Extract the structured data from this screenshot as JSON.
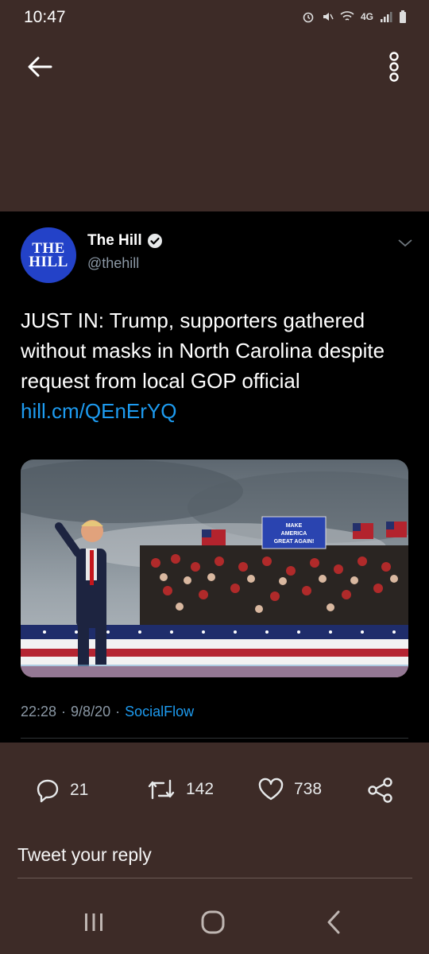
{
  "status_bar": {
    "time": "10:47",
    "network": "4G"
  },
  "tweet": {
    "author_name": "The Hill",
    "handle": "@thehill",
    "avatar_text_line1": "THE",
    "avatar_text_line2": "HILL",
    "text": "JUST IN: Trump, supporters gathered without masks in North Carolina despite request from local GOP official",
    "link": "hill.cm/QEnErYQ",
    "photo": {
      "sign_text_line1": "MAKE",
      "sign_text_line2": "AMERICA",
      "sign_text_line3": "GREAT AGAIN!"
    },
    "time": "22:28",
    "date": "9/8/20",
    "source": "SocialFlow",
    "separator": "·"
  },
  "actions": {
    "replies": "21",
    "retweets": "142",
    "likes": "738"
  },
  "reply_box": {
    "placeholder": "Tweet your reply"
  },
  "colors": {
    "background": "#3d2b27",
    "card": "#000000",
    "accent": "#1d9bf0",
    "avatar": "#2342c8"
  }
}
